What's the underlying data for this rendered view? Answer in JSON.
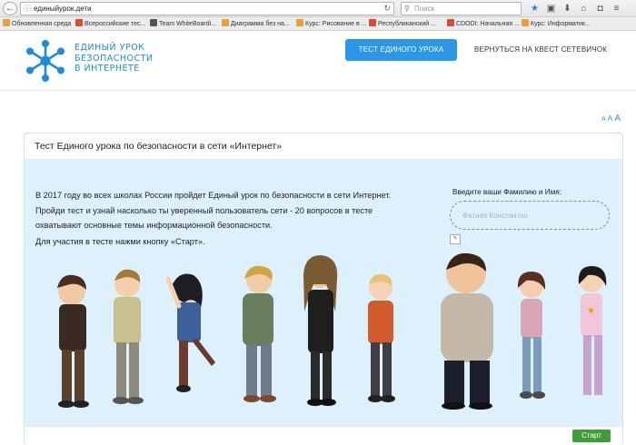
{
  "browser": {
    "url": "единыйурок.дети",
    "search_placeholder": "Поиск",
    "bookmarks": [
      {
        "label": "Обновленная среда",
        "color": "#e8a23a"
      },
      {
        "label": "Всероссийские тес...",
        "color": "#d8502f"
      },
      {
        "label": "Team WhiteBoardi...",
        "color": "#555555"
      },
      {
        "label": "Диаграмма без на...",
        "color": "#e8a23a"
      },
      {
        "label": "Курс: Рисование в ...",
        "color": "#e8a23a"
      },
      {
        "label": "Республиканский ...",
        "color": "#d84a3a"
      },
      {
        "label": "CDODI: Начальная ...",
        "color": "#d84a3a"
      },
      {
        "label": "Курс: Информатик...",
        "color": "#e8a23a"
      }
    ]
  },
  "site": {
    "logo_lines": [
      "ЕДИНЫЙ УРОК",
      "БЕЗОПАСНОСТИ",
      "В ИНТЕРНЕТЕ"
    ],
    "test_button": "ТЕСТ ЕДИНОГО УРОКА",
    "back_link": "ВЕРНУТЬСЯ НА КВЕСТ СЕТЕВИЧОК",
    "font_size": [
      "A",
      "A",
      "A"
    ],
    "accent_color": "#2c96e8"
  },
  "panel": {
    "title": "Тест Единого урока по безопасности в сети «Интернет»",
    "intro_lines": [
      "В 2017 году во всех школах России пройдет Единый урок по безопасности в сети Интернет.",
      "Пройди тест и узнай насколько ты уверенный пользователь сети - 20 вопросов в тесте",
      "охватывают основные темы информационной безопасности."
    ],
    "start_note": "Для участия в тесте нажми кнопку «Старт».",
    "name_label": "Введите ваши Фамилию и Имя:",
    "name_value": "Фатиев Константин",
    "start_button": "Старт"
  }
}
